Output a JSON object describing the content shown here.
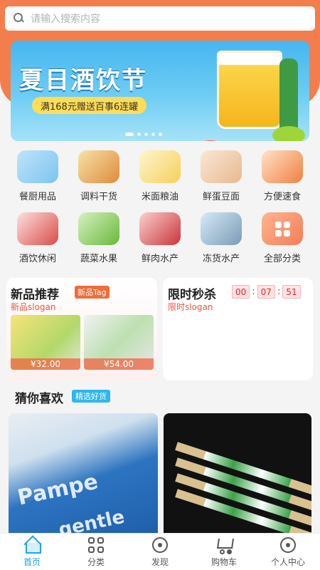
{
  "search": {
    "placeholder": "请输入搜索内容"
  },
  "banner": {
    "title": "夏日酒饮节",
    "subtitle": "满168元赠送百事6连罐",
    "active_dot": 0,
    "dot_count": 5
  },
  "categories": [
    {
      "label": "餐厨用品",
      "icon": "kitchen-supplies-icon"
    },
    {
      "label": "调料干货",
      "icon": "seasoning-icon"
    },
    {
      "label": "米面粮油",
      "icon": "rice-oil-icon"
    },
    {
      "label": "鲜蛋豆面",
      "icon": "eggs-tofu-icon"
    },
    {
      "label": "方便速食",
      "icon": "instant-food-icon"
    },
    {
      "label": "酒饮休闲",
      "icon": "drinks-icon"
    },
    {
      "label": "蔬菜水果",
      "icon": "vegetables-fruits-icon"
    },
    {
      "label": "鲜肉水产",
      "icon": "fresh-meat-icon"
    },
    {
      "label": "冻货水产",
      "icon": "frozen-seafood-icon"
    },
    {
      "label": "全部分类",
      "icon": "all-categories-icon"
    }
  ],
  "new_products": {
    "title": "新品推荐",
    "tag": "新品Tag",
    "slogan": "新品slogan",
    "items": [
      {
        "price": "¥32.00"
      },
      {
        "price": "¥54.00"
      }
    ]
  },
  "flash_sale": {
    "title": "限时秒杀",
    "hours": "00",
    "minutes": "07",
    "seconds": "51",
    "slogan": "限时slogan"
  },
  "guess": {
    "title": "猜你喜欢",
    "tag": "精选好货"
  },
  "nav": [
    {
      "label": "首页",
      "icon": "home-icon",
      "active": true
    },
    {
      "label": "分类",
      "icon": "category-grid-icon",
      "active": false
    },
    {
      "label": "发现",
      "icon": "discover-icon",
      "active": false
    },
    {
      "label": "购物车",
      "icon": "cart-icon",
      "active": false
    },
    {
      "label": "个人中心",
      "icon": "profile-icon",
      "active": false
    }
  ],
  "colors": {
    "header": "#f37d4b",
    "accent_blue": "#1fa3e8",
    "price_red": "#e3242b"
  }
}
